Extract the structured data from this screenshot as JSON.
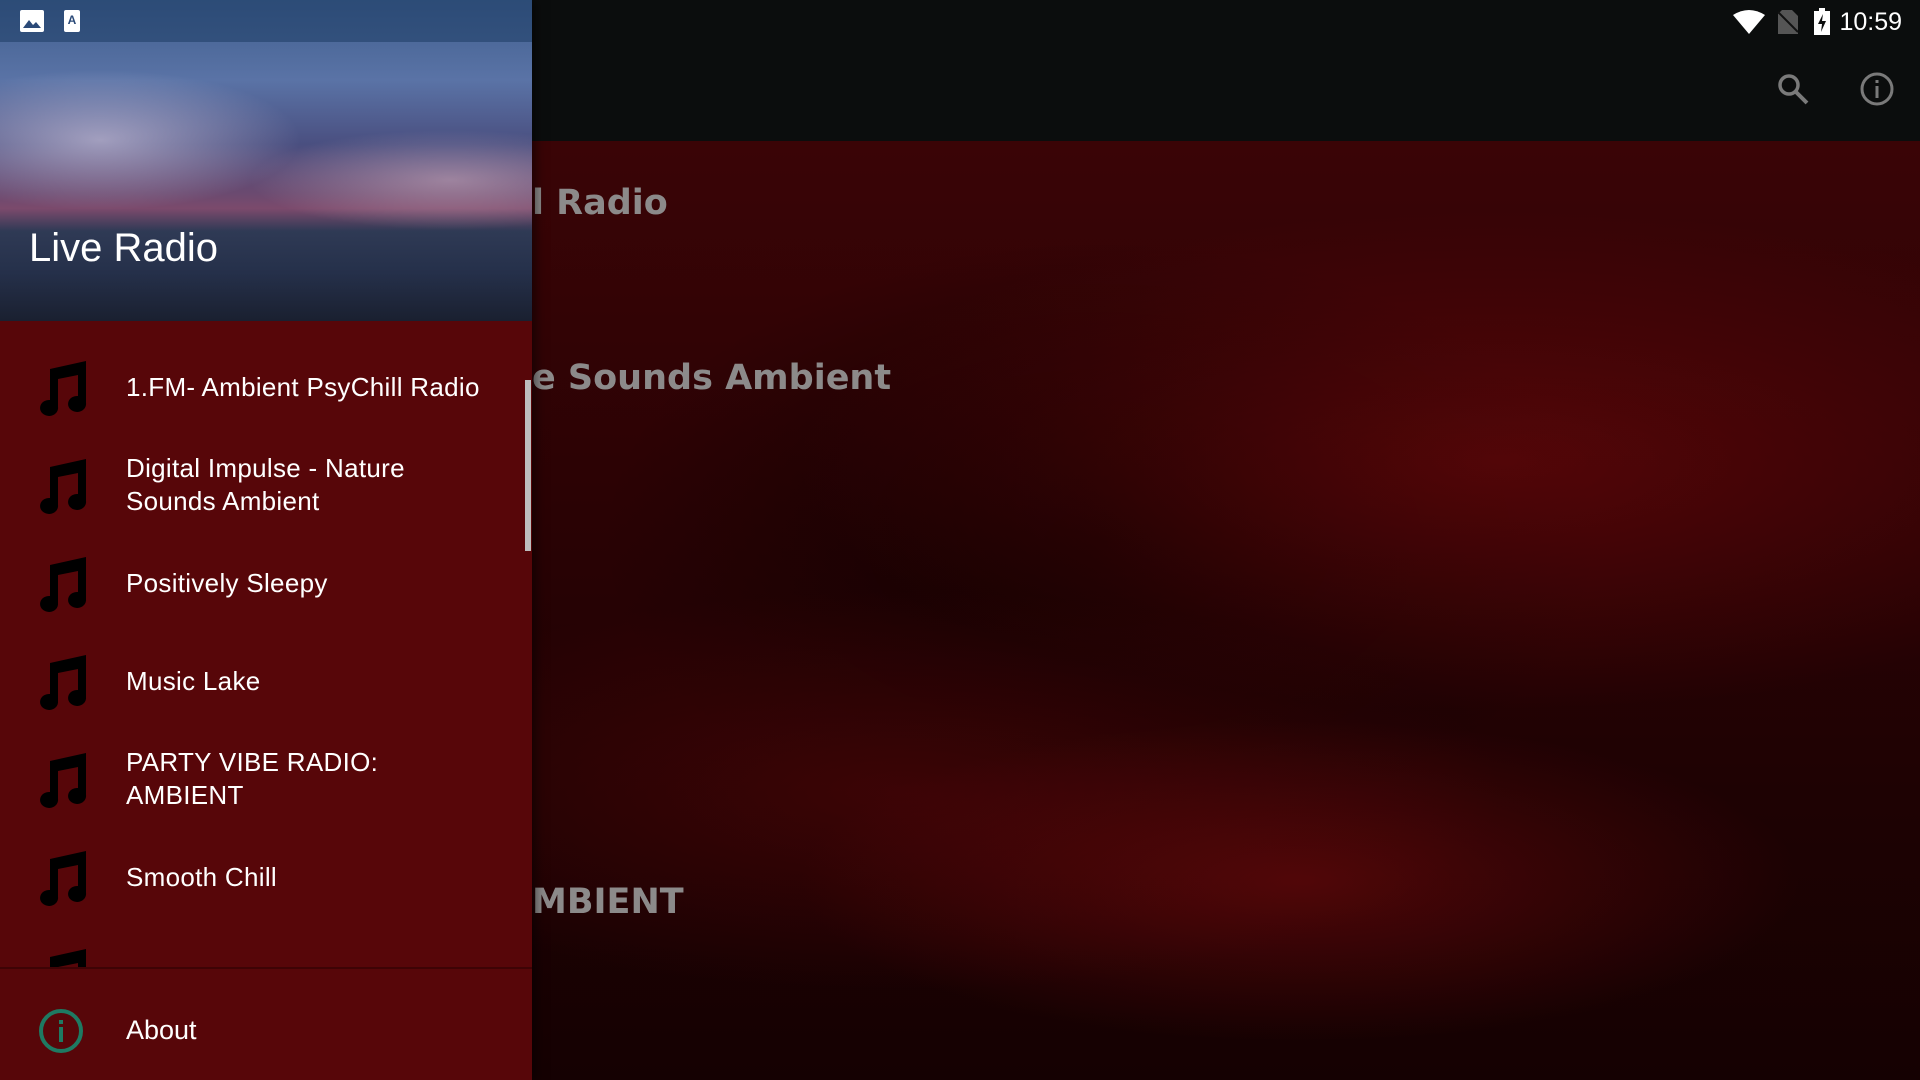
{
  "status_bar": {
    "time": "10:59",
    "left_icons": [
      "image-icon",
      "text-icon"
    ],
    "right_icons": [
      "wifi-icon",
      "no-sim-icon",
      "battery-charging-icon"
    ]
  },
  "app_bar": {
    "actions": [
      "search-icon",
      "info-icon"
    ]
  },
  "main": {
    "visible_titles": [
      "l Radio",
      "e Sounds Ambient",
      "MBIENT"
    ]
  },
  "drawer": {
    "header_title": "Live Radio",
    "items": [
      {
        "label": "1.FM- Ambient PsyChill Radio",
        "icon": "music-note-icon"
      },
      {
        "label": "Digital Impulse - Nature Sounds Ambient",
        "icon": "music-note-icon"
      },
      {
        "label": "Positively Sleepy",
        "icon": "music-note-icon"
      },
      {
        "label": "Music Lake",
        "icon": "music-note-icon"
      },
      {
        "label": "PARTY VIBE RADIO: AMBIENT",
        "icon": "music-note-icon"
      },
      {
        "label": "Smooth Chill",
        "icon": "music-note-icon"
      }
    ],
    "footer_item": {
      "label": "About",
      "icon": "info-icon"
    }
  },
  "colors": {
    "drawer_bg": "#570609",
    "about_icon": "#1e7a62",
    "app_bar": "#0b0d0d"
  }
}
